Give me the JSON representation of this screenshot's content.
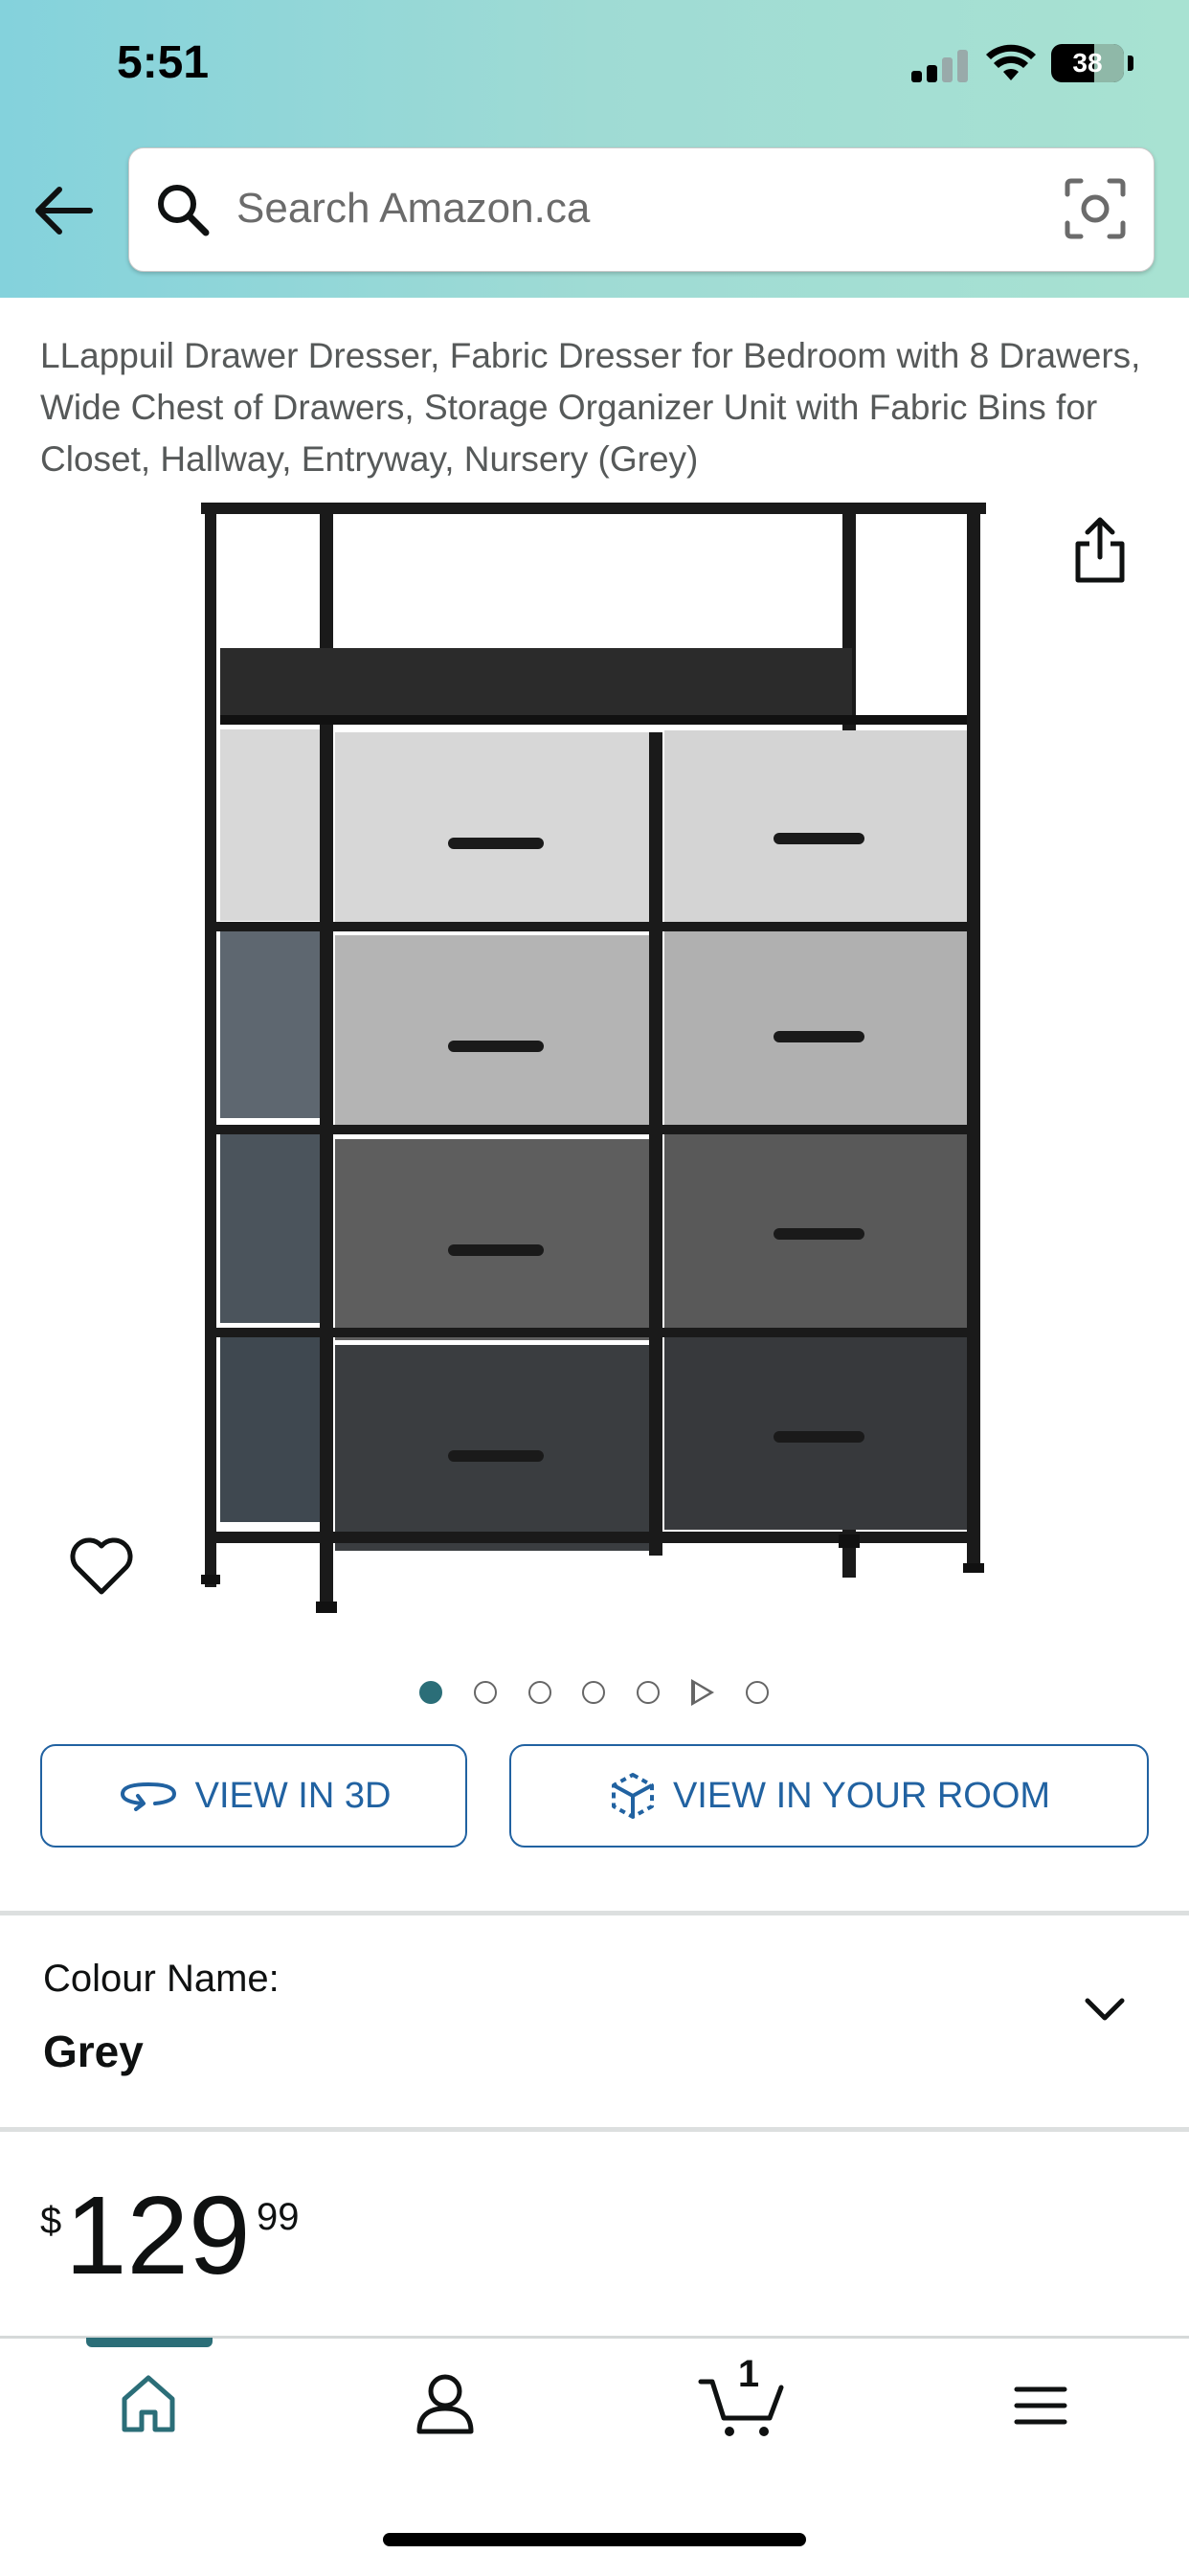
{
  "status_bar": {
    "time": "5:51",
    "battery": "38"
  },
  "search": {
    "placeholder": "Search Amazon.ca"
  },
  "product": {
    "title": "LLappuil Drawer Dresser, Fabric Dresser for Bedroom with 8 Drawers, Wide Chest of Drawers, Storage Organizer Unit with Fabric Bins for Closet, Hallway, Entryway, Nursery (Grey)"
  },
  "gallery": {
    "image_count": 7,
    "active_index": 0,
    "video_index": 5
  },
  "buttons": {
    "view_3d": "VIEW IN 3D",
    "view_room": "VIEW IN YOUR ROOM"
  },
  "colour": {
    "label": "Colour Name:",
    "value": "Grey"
  },
  "price": {
    "symbol": "$",
    "whole": "129",
    "fraction": "99"
  },
  "nav": {
    "cart_count": "1",
    "items": [
      "home",
      "account",
      "cart",
      "menu"
    ]
  },
  "colors": {
    "accent": "#2b6e78",
    "link": "#2162a1",
    "header_gradient_start": "#84d2dc",
    "header_gradient_end": "#a8e2d2"
  }
}
